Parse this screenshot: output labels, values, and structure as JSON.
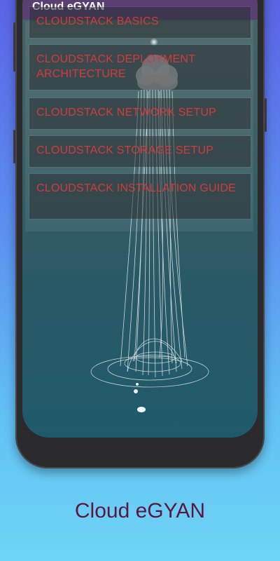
{
  "appbar": {
    "title": "Cloud eGYAN"
  },
  "menu": {
    "items": [
      {
        "label": "CLOUDSTACK BASICS"
      },
      {
        "label": "CLOUDSTACK DEPLOYMENT ARCHITECTURE"
      },
      {
        "label": "CLOUDSTACK NETWORK SETUP"
      },
      {
        "label": "CLOUDSTACK STORAGE SETUP"
      },
      {
        "label": "CLOUDSTACK INSTALLATION GUIDE"
      }
    ]
  },
  "caption": {
    "app_name": "Cloud eGYAN"
  },
  "colors": {
    "appbar": "#5a3f73",
    "item_text": "#d33a3a",
    "caption_text": "#5a1740"
  }
}
